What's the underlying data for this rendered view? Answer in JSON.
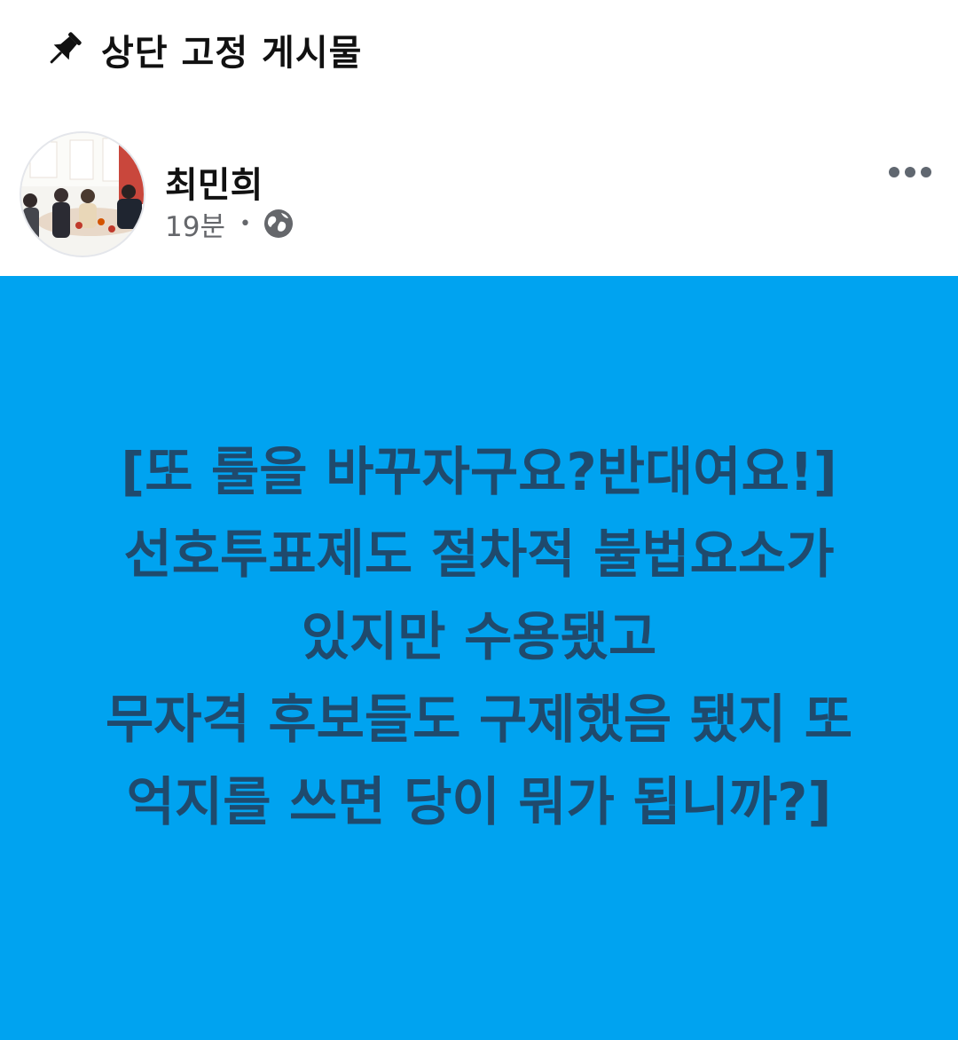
{
  "pinned": {
    "icon": "pushpin-icon",
    "label": "상단 고정 게시물"
  },
  "post": {
    "author": "최민희",
    "avatar_icon": "profile-photo",
    "time": "19분",
    "separator": "•",
    "audience_icon": "globe-icon",
    "more_icon": "more-options-icon",
    "background_color": "#00a3f0",
    "text_color": "#1f4a6d",
    "text_lines": [
      "[또 룰을 바꾸자구요?반대여요!]",
      "선호투표제도 절차적 불법요소가",
      "있지만 수용됐고",
      "무자격 후보들도 구제했음 됐지 또",
      "억지를 쓰면 당이 뭐가 됩니까?]"
    ]
  }
}
